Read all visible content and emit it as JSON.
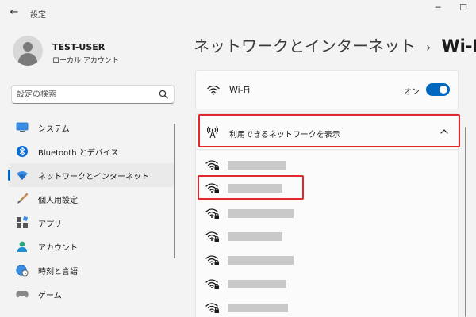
{
  "window": {
    "title": "設定",
    "back_glyph": "←",
    "minimize_glyph": "─",
    "maximize_glyph": "☐"
  },
  "user": {
    "name": "TEST-USER",
    "account_type": "ローカル アカウント"
  },
  "search": {
    "placeholder": "設定の検索"
  },
  "sidebar": {
    "items": [
      {
        "label": "システム",
        "icon": "monitor-icon",
        "active": false
      },
      {
        "label": "Bluetooth とデバイス",
        "icon": "bluetooth-icon",
        "active": false
      },
      {
        "label": "ネットワークとインターネット",
        "icon": "wifi-icon",
        "active": true
      },
      {
        "label": "個人用設定",
        "icon": "brush-icon",
        "active": false
      },
      {
        "label": "アプリ",
        "icon": "apps-icon",
        "active": false
      },
      {
        "label": "アカウント",
        "icon": "person-icon",
        "active": false
      },
      {
        "label": "時刻と言語",
        "icon": "globe-clock-icon",
        "active": false
      },
      {
        "label": "ゲーム",
        "icon": "gamepad-icon",
        "active": false
      }
    ]
  },
  "header": {
    "parent": "ネットワークとインターネット",
    "separator": "›",
    "current": "Wi-Fi"
  },
  "wifi_toggle": {
    "label": "Wi-Fi",
    "state_text": "オン",
    "on": true
  },
  "available": {
    "label": "利用できるネットワークを表示"
  },
  "colors": {
    "accent": "#0067c0",
    "highlight": "#e0282e",
    "redacted": "#c9c9c9"
  },
  "networks": [
    {
      "secured": true,
      "redacted_width": 0.65
    },
    {
      "secured": true,
      "redacted_width": 0.62
    },
    {
      "secured": true,
      "redacted_width": 0.74
    },
    {
      "secured": true,
      "redacted_width": 0.62
    },
    {
      "secured": true,
      "redacted_width": 0.74
    },
    {
      "secured": true,
      "redacted_width": 0.66
    },
    {
      "secured": true,
      "redacted_width": 0.68
    }
  ]
}
